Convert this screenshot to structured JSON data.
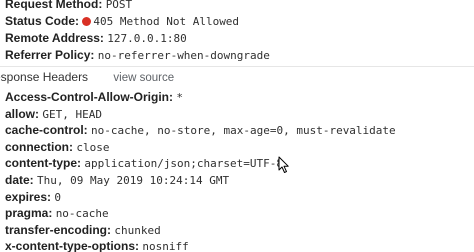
{
  "general": {
    "request_method": {
      "key": "Request Method:",
      "value": "POST"
    },
    "status_code": {
      "key": "Status Code:",
      "value": "405 Method Not Allowed",
      "status_color": "#d93025"
    },
    "remote_address": {
      "key": "Remote Address:",
      "value": "127.0.0.1:80"
    },
    "referrer_policy": {
      "key": "Referrer Policy:",
      "value": "no-referrer-when-downgrade"
    }
  },
  "response_headers": {
    "title": "esponse Headers",
    "view_source_label": "view source",
    "items": [
      {
        "key": "Access-Control-Allow-Origin:",
        "value": "*"
      },
      {
        "key": "allow:",
        "value": "GET, HEAD"
      },
      {
        "key": "cache-control:",
        "value": "no-cache, no-store, max-age=0, must-revalidate"
      },
      {
        "key": "connection:",
        "value": "close"
      },
      {
        "key": "content-type:",
        "value": "application/json;charset=UTF-8"
      },
      {
        "key": "date:",
        "value": "Thu, 09 May 2019 10:24:14 GMT"
      },
      {
        "key": "expires:",
        "value": "0"
      },
      {
        "key": "pragma:",
        "value": "no-cache"
      },
      {
        "key": "transfer-encoding:",
        "value": "chunked"
      },
      {
        "key": "x-content-type-options:",
        "value": "nosniff"
      }
    ]
  },
  "icons": {
    "cursor": "mouse-pointer-icon",
    "status": "status-error-dot-icon"
  }
}
